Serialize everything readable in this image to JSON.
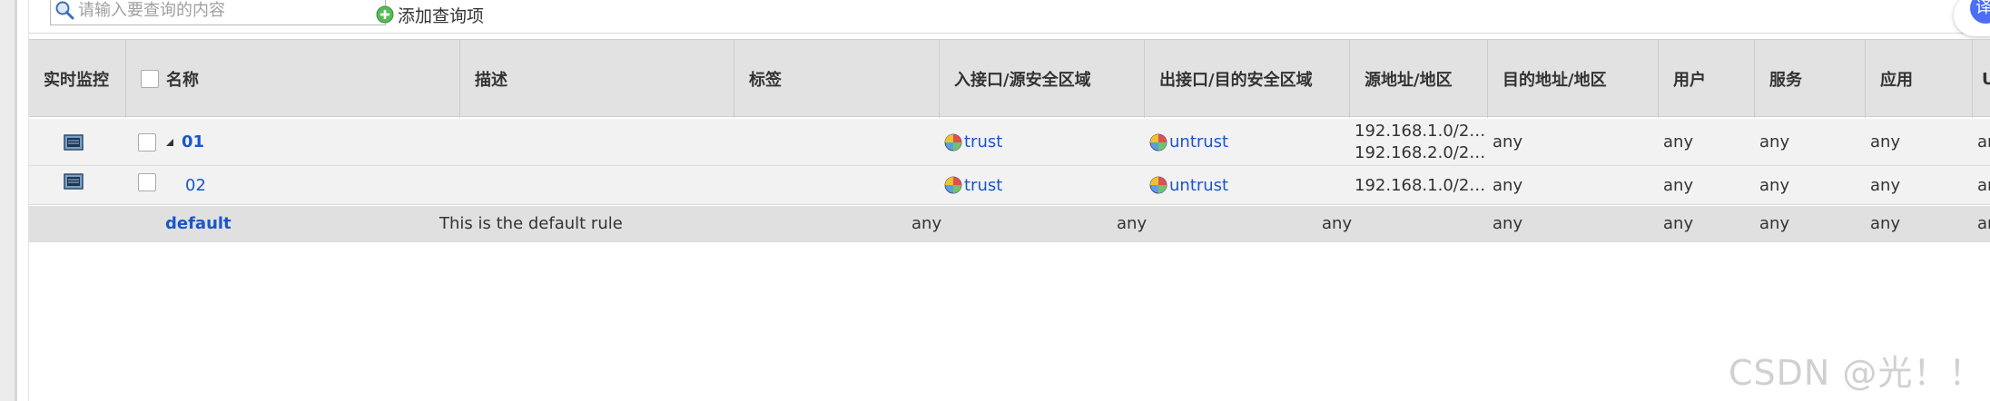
{
  "search": {
    "placeholder": "请输入要查询的内容"
  },
  "toolbar": {
    "add_query_label": "添加查询项"
  },
  "translate_button": {
    "label": "译"
  },
  "columns": {
    "monitor": "实时监控",
    "name": "名称",
    "description": "描述",
    "tag": "标签",
    "ingress": "入接口/源安全区域",
    "egress": "出接口/目的安全区域",
    "src_addr": "源地址/地区",
    "dst_addr": "目的地址/地区",
    "user": "用户",
    "service": "服务",
    "application": "应用",
    "url": "U"
  },
  "rows": [
    {
      "name": "01",
      "description": "",
      "tag": "",
      "ingress": "trust",
      "egress": "untrust",
      "src_addr": [
        "192.168.1.0/2…",
        "192.168.2.0/2…"
      ],
      "dst_addr": "any",
      "user": "any",
      "service": "any",
      "application": "any",
      "url": "ar"
    },
    {
      "name": "02",
      "description": "",
      "tag": "",
      "ingress": "trust",
      "egress": "untrust",
      "src_addr": [
        "192.168.1.0/2…"
      ],
      "dst_addr": "any",
      "user": "any",
      "service": "any",
      "application": "any",
      "url": "ar"
    },
    {
      "name": "default",
      "description": "This is the default rule",
      "tag": "",
      "ingress": "any",
      "egress": "any",
      "src_addr": [
        "any"
      ],
      "dst_addr": "any",
      "user": "any",
      "service": "any",
      "application": "any",
      "url": "ar"
    }
  ],
  "watermark": "CSDN @光！！",
  "colors": {
    "link": "#1a56c8",
    "header_bg": "#e2e2e2",
    "row_bg": "#f2f2f2",
    "default_row_bg": "#e0e0e0"
  }
}
